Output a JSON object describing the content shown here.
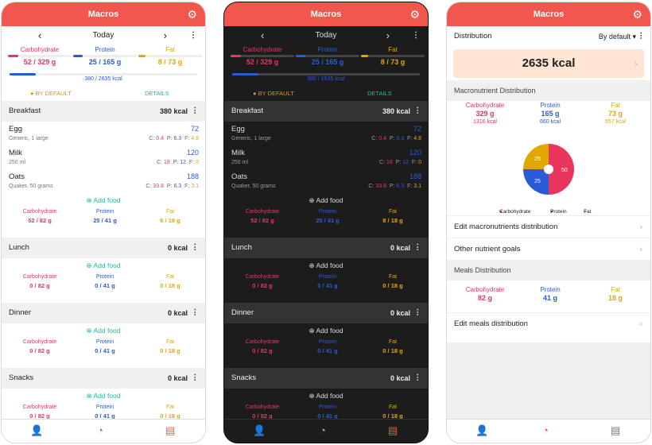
{
  "app": {
    "title": "Macros",
    "gear": "⚙"
  },
  "day": {
    "label": "Today"
  },
  "summary": {
    "carb_label": "Carbohydrate",
    "carb_val": "52 / 329 g",
    "carb_pct": 16,
    "prot_label": "Protein",
    "prot_val": "25 / 165 g",
    "prot_pct": 15,
    "fat_label": "Fat",
    "fat_val": "8 / 73 g",
    "fat_pct": 11,
    "total": "380 / 2635 kcal",
    "total_pct": 14,
    "default_label": "BY DEFAULT",
    "details_label": "DETAILS"
  },
  "breakfast": {
    "name": "Breakfast",
    "kcal": "380 kcal",
    "foods": [
      {
        "name": "Egg",
        "desc": "Generic, 1 large",
        "kcal": "72",
        "c": "0.4",
        "p": "6.3",
        "f": "4.8"
      },
      {
        "name": "Milk",
        "desc": "250 ml",
        "kcal": "120",
        "c": "18",
        "p": "12",
        "f": "0"
      },
      {
        "name": "Oats",
        "desc": "Quaker, 50 grams",
        "kcal": "188",
        "c": "33.8",
        "p": "6.3",
        "f": "3.1"
      }
    ],
    "add": "Add food",
    "carb": "52 / 82 g",
    "prot": "25 / 41 g",
    "fat_light": "6 / 18 g",
    "fat_dark": "8 / 18 g"
  },
  "lunch": {
    "name": "Lunch",
    "kcal": "0 kcal",
    "add": "Add food",
    "carb": "0 / 82 g",
    "prot": "0 / 41 g",
    "fat": "0 / 18 g"
  },
  "dinner": {
    "name": "Dinner",
    "kcal": "0 kcal",
    "add": "Add food",
    "carb": "0 / 82 g",
    "prot": "0 / 41 g",
    "fat": "0 / 18 g"
  },
  "snacks": {
    "name": "Snacks",
    "kcal": "0 kcal",
    "add": "Add food",
    "carb": "0 / 82 g",
    "prot": "0 / 41 g",
    "fat": "0 / 18 g"
  },
  "labels": {
    "carb": "Carbohydrate",
    "prot": "Protein",
    "fat": "Fat",
    "c": "C:",
    "p": "P:",
    "f": "F:"
  },
  "distribution": {
    "title": "Distribution",
    "by": "By default",
    "kcal": "2635 kcal",
    "macro_section": "Macronutrient Distribution",
    "carb_g": "329 g",
    "carb_kcal": "1316 kcal",
    "prot_g": "165 g",
    "prot_kcal": "660 kcal",
    "fat_g": "73 g",
    "fat_kcal": "657 kcal",
    "pie": {
      "carb": 50,
      "prot": 25,
      "fat": 25
    },
    "edit_macro": "Edit macronutrients distribution",
    "other_goals": "Other nutrient goals",
    "meals_section": "Meals Distribution",
    "meal_carb": "82 g",
    "meal_prot": "41 g",
    "meal_fat": "18 g",
    "edit_meals": "Edit meals distribution"
  },
  "colors": {
    "accent": "#f2574e",
    "carb": "#e8365d",
    "prot": "#2a5bd7",
    "fat": "#e0a800",
    "green": "#1abc9c"
  },
  "icons": {
    "user": "person-icon",
    "chart": "pie-chart-icon",
    "diary": "diary-icon"
  }
}
